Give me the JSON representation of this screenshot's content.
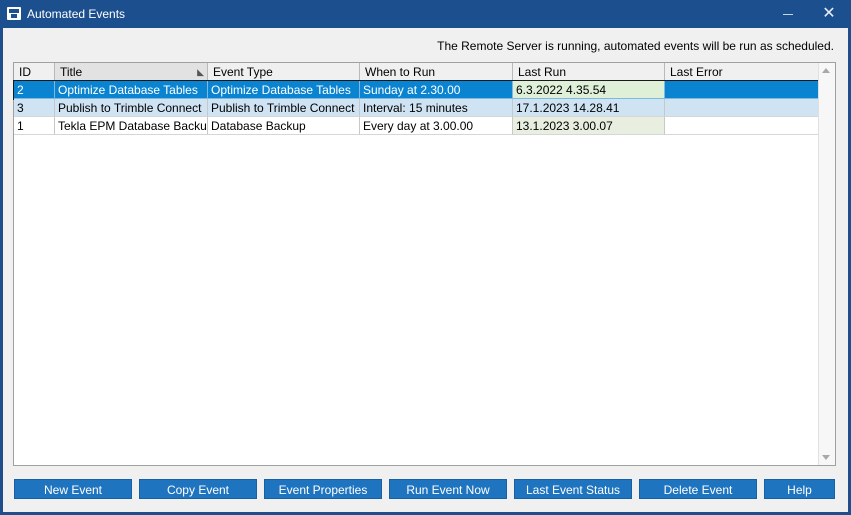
{
  "window": {
    "title": "Automated Events",
    "close_glyph": "✕",
    "icon": "app-icon"
  },
  "status_message": "The Remote Server is running, automated events will be run as scheduled.",
  "grid": {
    "columns": [
      "ID",
      "Title",
      "Event Type",
      "When to Run",
      "Last Run",
      "Last Error"
    ],
    "sorted_column": "Title",
    "rows": [
      {
        "id": "2",
        "title": "Optimize Database Tables",
        "event_type": "Optimize Database Tables",
        "when": "Sunday at 2.30.00",
        "last_run": "6.3.2022 4.35.54",
        "last_error": "",
        "state": "selected"
      },
      {
        "id": "3",
        "title": "Publish to Trimble Connect",
        "event_type": "Publish to Trimble Connect",
        "when": "Interval: 15 minutes",
        "last_run": "17.1.2023 14.28.41",
        "last_error": "",
        "state": "alt"
      },
      {
        "id": "1",
        "title": "Tekla EPM Database Backup",
        "event_type": "Database Backup",
        "when": "Every day at 3.00.00",
        "last_run": "13.1.2023 3.00.07",
        "last_error": "",
        "state": "normal"
      }
    ]
  },
  "buttons": {
    "new_event": "New Event",
    "copy_event": "Copy Event",
    "event_properties": "Event Properties",
    "run_event_now": "Run Event Now",
    "last_event_status": "Last Event Status",
    "delete_event": "Delete Event",
    "help": "Help"
  },
  "colors": {
    "titlebar": "#1c4f8e",
    "selection": "#0a84d0",
    "alt_row": "#cfe3f3",
    "last_run_cell": "#e8efe0",
    "button": "#1f74bf"
  }
}
